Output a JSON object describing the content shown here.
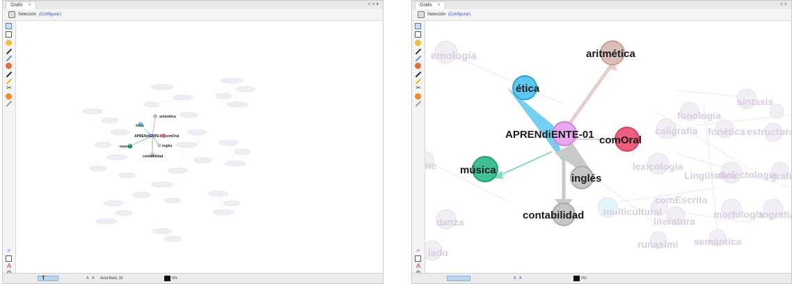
{
  "left_window": {
    "tab_title": "Grafo",
    "tab_close": "×",
    "window_controls": "< > ▾",
    "toolbar": {
      "selection_label": "Selección",
      "configure_link": "(Configurar)"
    },
    "status": {
      "zoom_text": "T",
      "font_label": "Arial Bold, 32",
      "scale_a": "A",
      "scale_b": "A",
      "percent": "0%"
    },
    "graph": {
      "focus_nodes": [
        {
          "label": "aritmética",
          "color": "#cdb5b0"
        },
        {
          "label": "ética",
          "color": "#5cc8ee"
        },
        {
          "label": "APRENdiENTE-01",
          "color": "#e7a8ef"
        },
        {
          "label": "comOral",
          "color": "#ee5f7d"
        },
        {
          "label": "música",
          "color": "#3fbf95"
        },
        {
          "label": "inglés",
          "color": "#c6c6c6"
        },
        {
          "label": "contabilidad",
          "color": "#c6c6c6"
        }
      ]
    }
  },
  "right_window": {
    "tab_title": "Grafo",
    "tab_close": "×",
    "window_controls": "< >",
    "toolbar": {
      "selection_label": "Selección",
      "configure_link": "(Configurar)"
    },
    "status": {
      "scale_a": "A",
      "scale_b": "A",
      "percent": "0%"
    },
    "graph": {
      "center": {
        "label": "APRENdiENTE-01",
        "color": "#e7a8ef"
      },
      "nodes": [
        {
          "label": "aritmética",
          "color": "#d8bfba"
        },
        {
          "label": "ética",
          "color": "#5cc8ee"
        },
        {
          "label": "comOral",
          "color": "#ee5f7d"
        },
        {
          "label": "música",
          "color": "#3fbf95"
        },
        {
          "label": "inglés",
          "color": "#c6c6c6"
        },
        {
          "label": "contabilidad",
          "color": "#c6c6c6"
        }
      ],
      "background_labels": [
        {
          "label": "emología"
        },
        {
          "label": "sintaxis"
        },
        {
          "label": "fonología"
        },
        {
          "label": "caligrafía"
        },
        {
          "label": "fonética"
        },
        {
          "label": "estructura"
        },
        {
          "label": "lexicología"
        },
        {
          "label": "Lingüística"
        },
        {
          "label": "dialectología"
        },
        {
          "label": "grafía"
        },
        {
          "label": "comEscrita"
        },
        {
          "label": "multicultural"
        },
        {
          "label": "literatura"
        },
        {
          "label": "morfología"
        },
        {
          "label": "ortografía"
        },
        {
          "label": "danza"
        },
        {
          "label": "runasimi"
        },
        {
          "label": "semántica"
        },
        {
          "label": "lado"
        },
        {
          "label": "ne"
        }
      ]
    }
  }
}
